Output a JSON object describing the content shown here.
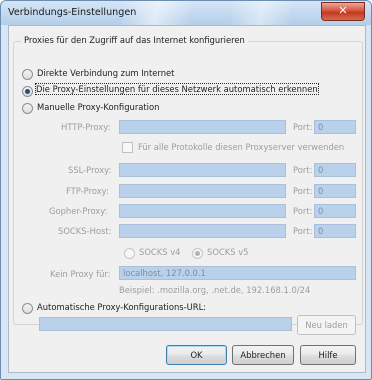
{
  "window": {
    "title": "Verbindungs-Einstellungen",
    "close_glyph": "✕"
  },
  "group_title": "Proxies für den Zugriff auf das Internet konfigurieren",
  "options": {
    "direct": "Direkte Verbindung zum Internet",
    "auto_detect": "Die Proxy-Einstellungen für dieses Netzwerk automatisch erkennen",
    "manual": "Manuelle Proxy-Konfiguration",
    "auto_url": "Automatische Proxy-Konfigurations-URL:"
  },
  "manual": {
    "http_label": "HTTP-Proxy:",
    "ssl_label": "SSL-Proxy:",
    "ftp_label": "FTP-Proxy:",
    "gopher_label": "Gopher-Proxy:",
    "socks_label": "SOCKS-Host:",
    "port_label": "Port:",
    "port_value": "0",
    "use_all_checkbox": "Für alle Protokolle diesen Proxyserver verwenden",
    "socks_v4": "SOCKS v4",
    "socks_v5": "SOCKS v5",
    "no_proxy_label": "Kein Proxy für:",
    "no_proxy_value": "localhost, 127.0.0.1",
    "example": "Beispiel: .mozilla.org, .net.de, 192.168.1.0/24"
  },
  "buttons": {
    "reload": "Neu laden",
    "ok": "OK",
    "cancel": "Abbrechen",
    "help": "Hilfe"
  },
  "colors": {
    "disabled_field": "#b9d1ea",
    "title_bar": "#c2d8ef",
    "close_button": "#c13a22"
  }
}
